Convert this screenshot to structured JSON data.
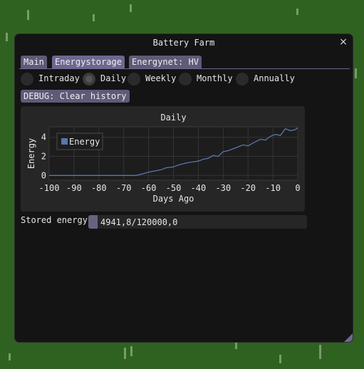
{
  "window": {
    "title": "Battery Farm",
    "close_icon": "×"
  },
  "tabs": [
    {
      "label": "Main",
      "active": false
    },
    {
      "label": "Energystorage",
      "active": true
    },
    {
      "label": "Energynet: HV",
      "active": false
    }
  ],
  "period_options": [
    {
      "label": "Intraday",
      "checked": false
    },
    {
      "label": "Daily",
      "checked": true
    },
    {
      "label": "Weekly",
      "checked": false
    },
    {
      "label": "Monthly",
      "checked": false
    },
    {
      "label": "Annually",
      "checked": false
    }
  ],
  "debug_button": {
    "label": "DEBUG: Clear history"
  },
  "chart_data": {
    "type": "line",
    "title": "Daily",
    "xlabel": "Days Ago",
    "ylabel": "Energy",
    "xlim": [
      -100,
      0
    ],
    "ylim": [
      -0.5,
      5.1
    ],
    "xticks": [
      -100,
      -90,
      -80,
      -70,
      -60,
      -50,
      -40,
      -30,
      -20,
      -10,
      0
    ],
    "yticks": [
      0,
      2,
      4
    ],
    "grid": true,
    "legend_position": "top-left",
    "series": [
      {
        "name": "Energy",
        "color": "#5876ac",
        "points": [
          [
            -100,
            0
          ],
          [
            -90,
            0
          ],
          [
            -80,
            0
          ],
          [
            -70,
            0
          ],
          [
            -65,
            0
          ],
          [
            -62,
            0.2
          ],
          [
            -60,
            0.35
          ],
          [
            -57,
            0.5
          ],
          [
            -55,
            0.6
          ],
          [
            -53,
            0.8
          ],
          [
            -50,
            0.9
          ],
          [
            -48,
            1.1
          ],
          [
            -45,
            1.3
          ],
          [
            -43,
            1.4
          ],
          [
            -40,
            1.5
          ],
          [
            -38,
            1.7
          ],
          [
            -36,
            1.8
          ],
          [
            -34,
            2.1
          ],
          [
            -32,
            2.0
          ],
          [
            -30,
            2.5
          ],
          [
            -28,
            2.6
          ],
          [
            -25,
            2.9
          ],
          [
            -22,
            3.2
          ],
          [
            -20,
            3.1
          ],
          [
            -18,
            3.4
          ],
          [
            -15,
            3.8
          ],
          [
            -13,
            3.7
          ],
          [
            -11,
            4.1
          ],
          [
            -9,
            4.3
          ],
          [
            -7,
            4.2
          ],
          [
            -5,
            4.9
          ],
          [
            -3,
            4.7
          ],
          [
            -1,
            4.8
          ],
          [
            0,
            5.0
          ]
        ]
      }
    ]
  },
  "stored_energy": {
    "label": "Stored energy",
    "value_text": "4941,8/120000,0",
    "fraction": 0.0412
  },
  "colors": {
    "window_bg": "#141414",
    "tab": "#5e5a78",
    "accent": "#6c6890",
    "plot_bg": "#262626",
    "series": "#5876ac"
  }
}
